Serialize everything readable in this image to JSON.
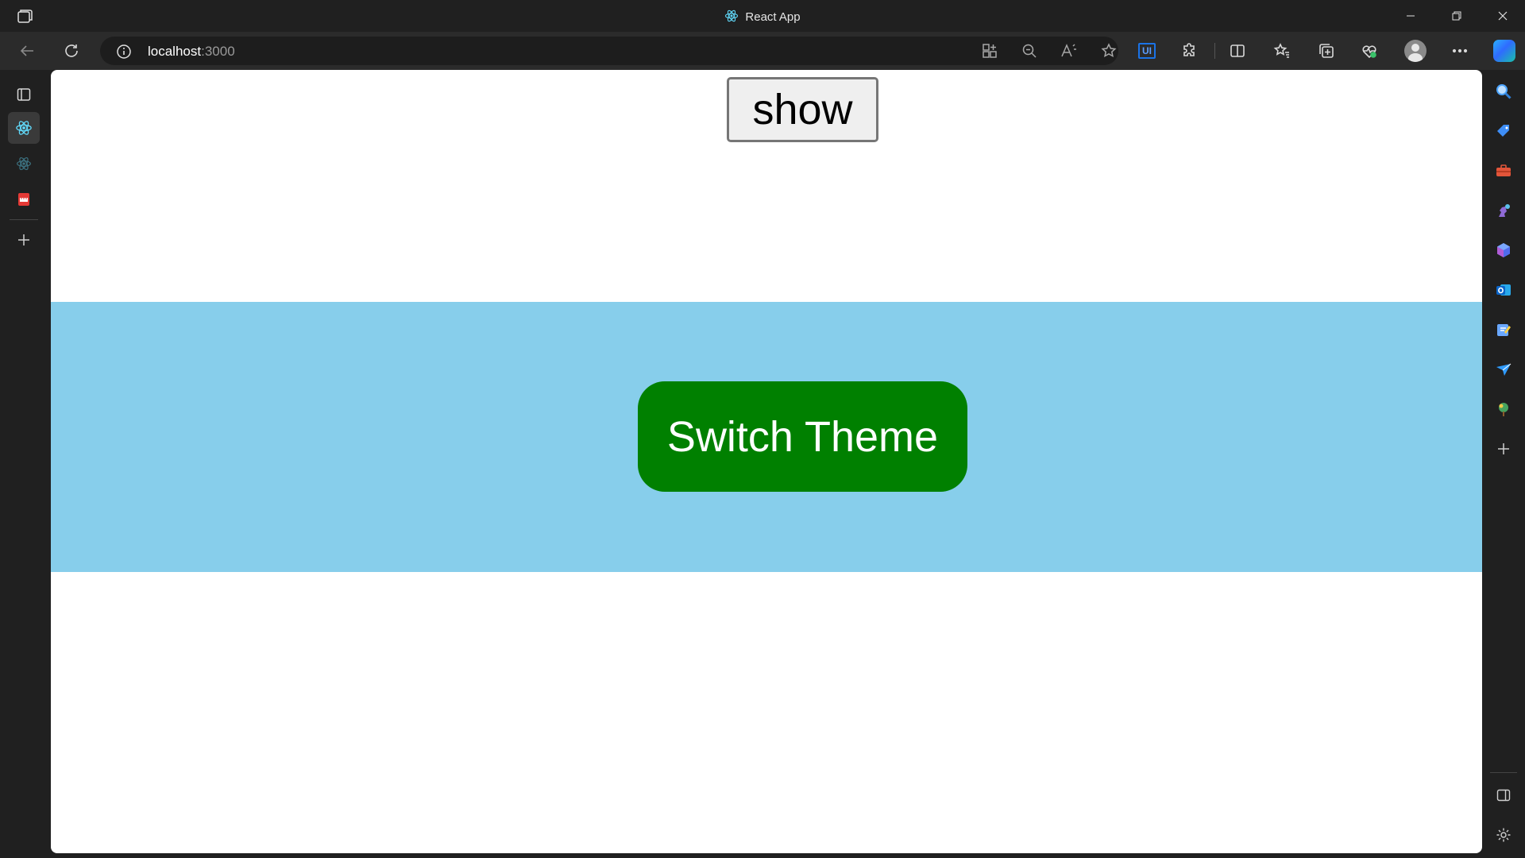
{
  "window": {
    "title": "React App",
    "minimize_icon": "minimize-icon",
    "restore_icon": "restore-icon",
    "close_icon": "close-icon"
  },
  "toolbar": {
    "url_host": "localhost",
    "url_port": ":3000",
    "icons": [
      "back-icon",
      "refresh-icon",
      "site-info-icon",
      "app-available-icon",
      "zoom-out-icon",
      "read-aloud-icon",
      "favorite-star-icon",
      "ui-extension-icon",
      "extensions-icon",
      "split-screen-icon",
      "favorites-icon",
      "collections-icon",
      "browser-essentials-icon",
      "profile-avatar",
      "more-options-icon",
      "copilot-icon"
    ],
    "ui_badge_text": "UI"
  },
  "left_tabs": {
    "items": [
      "tab-actions-icon",
      "react-app-tab",
      "react-tab-2",
      "pdf-tab",
      "new-tab-icon"
    ]
  },
  "right_sidebar": {
    "items": [
      "search-icon",
      "shopping-tag-icon",
      "tools-icon",
      "games-icon",
      "microsoft-365-icon",
      "outlook-icon",
      "drop-icon",
      "send-icon",
      "tree-icon",
      "add-sidebar-icon",
      "hide-sidebar-icon",
      "settings-icon"
    ]
  },
  "page": {
    "show_button_label": "show",
    "switch_button_label": "Switch Theme",
    "theme_band_color": "#87ceeb",
    "switch_button_color": "#008000"
  }
}
